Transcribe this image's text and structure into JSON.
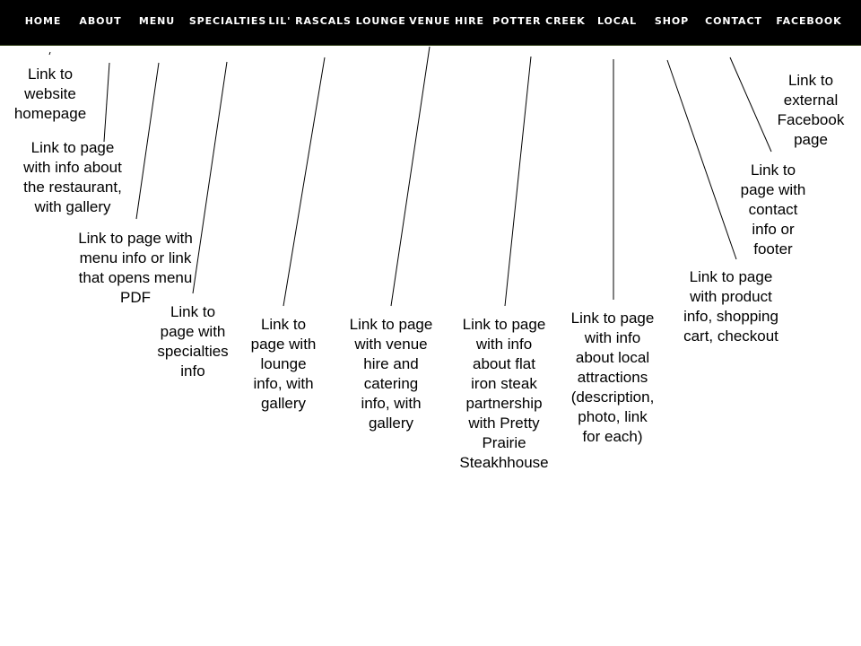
{
  "nav": {
    "items": [
      {
        "label": "HOME"
      },
      {
        "label": "ABOUT"
      },
      {
        "label": "MENU"
      },
      {
        "label": "SPECIALTIES"
      },
      {
        "label": "LIL' RASCALS LOUNGE"
      },
      {
        "label": "VENUE HIRE"
      },
      {
        "label": "POTTER CREEK"
      },
      {
        "label": "LOCAL"
      },
      {
        "label": "SHOP"
      },
      {
        "label": "CONTACT"
      },
      {
        "label": "FACEBOOK"
      }
    ]
  },
  "annotations": [
    {
      "text": "Link to\nwebsite\nhomepage"
    },
    {
      "text": "Link to page\nwith info about\nthe restaurant,\nwith gallery"
    },
    {
      "text": "Link to page with\nmenu info or link\nthat opens menu\nPDF"
    },
    {
      "text": "Link to\npage with\nspecialties\ninfo"
    },
    {
      "text": "Link to\npage with\nlounge\ninfo, with\ngallery"
    },
    {
      "text": "Link to page\nwith venue\nhire and\ncatering\ninfo, with\ngallery"
    },
    {
      "text": "Link to page\nwith info\nabout flat\niron steak\npartnership\nwith Pretty\nPrairie\nSteakhhouse"
    },
    {
      "text": "Link to page\nwith info\nabout local\nattractions\n(description,\nphoto, link\nfor each)"
    },
    {
      "text": "Link to page\nwith product\ninfo, shopping\ncart, checkout"
    },
    {
      "text": "Link to\npage with\ncontact\ninfo or\nfooter"
    },
    {
      "text": "Link to\nexternal\nFacebook\npage"
    }
  ]
}
